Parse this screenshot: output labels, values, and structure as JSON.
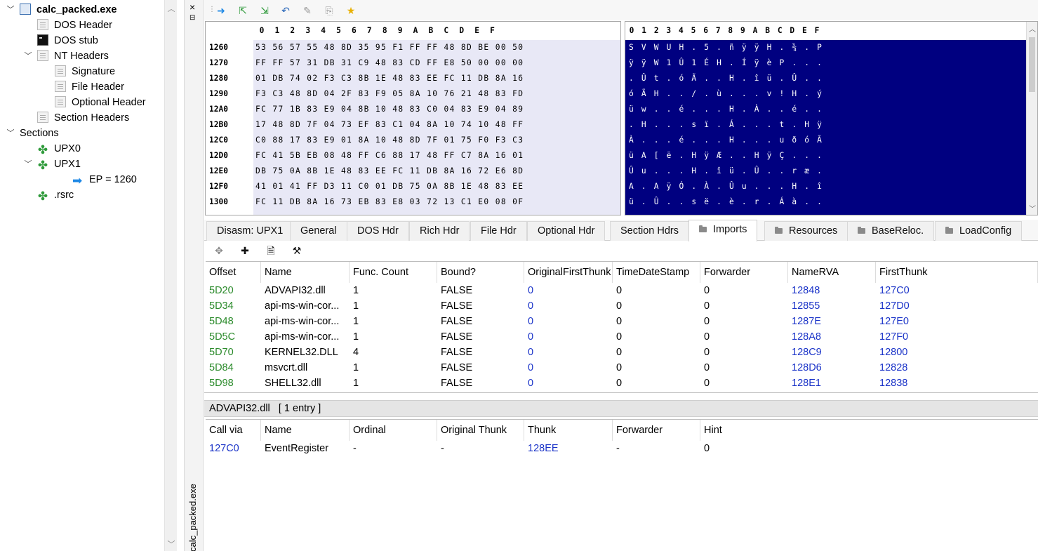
{
  "tree": {
    "items": [
      {
        "label": "calc_packed.exe",
        "icon": "exe-file-icon",
        "level": 0,
        "expanded": true,
        "bold": true
      },
      {
        "label": "DOS Header",
        "icon": "document-icon",
        "level": 1
      },
      {
        "label": "DOS stub",
        "icon": "dos-console-icon",
        "level": 1
      },
      {
        "label": "NT Headers",
        "icon": "document-icon",
        "level": 1,
        "expanded": true
      },
      {
        "label": "Signature",
        "icon": "document-icon",
        "level": 2
      },
      {
        "label": "File Header",
        "icon": "document-icon",
        "level": 2
      },
      {
        "label": "Optional Header",
        "icon": "document-icon",
        "level": 2
      },
      {
        "label": "Section Headers",
        "icon": "document-icon",
        "level": 1
      },
      {
        "label": "Sections",
        "icon": "none",
        "level": 0,
        "expanded": true
      },
      {
        "label": "UPX0",
        "icon": "puzzle-icon",
        "level": 1
      },
      {
        "label": "UPX1",
        "icon": "puzzle-icon",
        "level": 1,
        "expanded": true
      },
      {
        "label": "EP = 1260",
        "icon": "entry-point-arrow-icon",
        "level": 2
      },
      {
        "label": ".rsrc",
        "icon": "puzzle-icon",
        "level": 1
      }
    ]
  },
  "side_strip": {
    "close": "×",
    "pin": "⊟",
    "label": "calc_packed.exe"
  },
  "toolbar": {
    "buttons": [
      {
        "name": "go-to-address-icon",
        "glyph": "➜"
      },
      {
        "name": "go-to-entry-icon",
        "glyph": "⇱"
      },
      {
        "name": "go-to-rva-icon",
        "glyph": "⇲"
      },
      {
        "name": "undo-icon",
        "glyph": "↶"
      },
      {
        "name": "pin-icon",
        "glyph": "✎"
      },
      {
        "name": "copy-icon",
        "glyph": "⎘"
      },
      {
        "name": "favorite-star-icon",
        "glyph": "★"
      }
    ]
  },
  "hex": {
    "columns": [
      "0",
      "1",
      "2",
      "3",
      "4",
      "5",
      "6",
      "7",
      "8",
      "9",
      "A",
      "B",
      "C",
      "D",
      "E",
      "F"
    ],
    "rows": [
      {
        "addr": "1260",
        "bytes": "53 56 57 55 48 8D 35 95 F1 FF FF 48 8D BE 00 50",
        "ascii": "S V W U H . 5 . ñ ÿ ÿ H . ¾ . P"
      },
      {
        "addr": "1270",
        "bytes": "FF FF 57 31 DB 31 C9 48 83 CD FF E8 50 00 00 00",
        "ascii": "ÿ ÿ W 1 Û 1 É H . Í ÿ è P . . ."
      },
      {
        "addr": "1280",
        "bytes": "01 DB 74 02 F3 C3 8B 1E 48 83 EE FC 11 DB 8A 16",
        "ascii": ". Û t . ó Ã . . H . î ü . Û . ."
      },
      {
        "addr": "1290",
        "bytes": "F3 C3 48 8D 04 2F 83 F9 05 8A 10 76 21 48 83 FD",
        "ascii": "ó Ã H . . / . ù . . . v ! H . ý"
      },
      {
        "addr": "12A0",
        "bytes": "FC 77 1B 83 E9 04 8B 10 48 83 C0 04 83 E9 04 89",
        "ascii": "ü w . . é . . . H . À . . é . ."
      },
      {
        "addr": "12B0",
        "bytes": "17 48 8D 7F 04 73 EF 83 C1 04 8A 10 74 10 48 FF",
        "ascii": ". H . . . s ï . Á . . . t . H ÿ"
      },
      {
        "addr": "12C0",
        "bytes": "C0 88 17 83 E9 01 8A 10 48 8D 7F 01 75 F0 F3 C3",
        "ascii": "À . . . é . . . H . . . u ð ó Ã"
      },
      {
        "addr": "12D0",
        "bytes": "FC 41 5B EB 08 48 FF C6 88 17 48 FF C7 8A 16 01",
        "ascii": "ü A [ ë . H ÿ Æ . . H ÿ Ç . . ."
      },
      {
        "addr": "12E0",
        "bytes": "DB 75 0A 8B 1E 48 83 EE FC 11 DB 8A 16 72 E6 8D",
        "ascii": "Û u . . . H . î ü . Û . . r æ ."
      },
      {
        "addr": "12F0",
        "bytes": "41 01 41 FF D3 11 C0 01 DB 75 0A 8B 1E 48 83 EE",
        "ascii": "A . A ÿ Ó . À . Û u . . . H . î"
      },
      {
        "addr": "1300",
        "bytes": "FC 11 DB 8A 16 73 EB 83 E8 03 72 13 C1 E0 08 0F",
        "ascii": "ü . Û . . s ë . è . r . Á à . ."
      }
    ]
  },
  "tabs": [
    {
      "label": "Disasm: UPX1",
      "folder": false,
      "active": false
    },
    {
      "label": "General",
      "folder": false,
      "active": false
    },
    {
      "label": "DOS Hdr",
      "folder": false,
      "active": false
    },
    {
      "label": "Rich Hdr",
      "folder": false,
      "active": false
    },
    {
      "label": "File Hdr",
      "folder": false,
      "active": false
    },
    {
      "label": "Optional Hdr",
      "folder": false,
      "active": false
    },
    {
      "label": "Section Hdrs",
      "folder": false,
      "active": false
    },
    {
      "label": "Imports",
      "folder": true,
      "active": true
    },
    {
      "label": "Resources",
      "folder": true,
      "active": false
    },
    {
      "label": "BaseReloc.",
      "folder": true,
      "active": false
    },
    {
      "label": "LoadConfig",
      "folder": true,
      "active": false
    }
  ],
  "subtoolbar": [
    {
      "name": "move-icon",
      "glyph": "✥"
    },
    {
      "name": "add-icon",
      "glyph": "✚"
    },
    {
      "name": "save-icon",
      "glyph": "🗎"
    },
    {
      "name": "wand-icon",
      "glyph": "⚒"
    }
  ],
  "imports": {
    "headers": [
      "Offset",
      "Name",
      "Func. Count",
      "Bound?",
      "OriginalFirstThunk",
      "TimeDateStamp",
      "Forwarder",
      "NameRVA",
      "FirstThunk"
    ],
    "rows": [
      [
        "5D20",
        "ADVAPI32.dll",
        "1",
        "FALSE",
        "0",
        "0",
        "0",
        "12848",
        "127C0"
      ],
      [
        "5D34",
        "api-ms-win-cor...",
        "1",
        "FALSE",
        "0",
        "0",
        "0",
        "12855",
        "127D0"
      ],
      [
        "5D48",
        "api-ms-win-cor...",
        "1",
        "FALSE",
        "0",
        "0",
        "0",
        "1287E",
        "127E0"
      ],
      [
        "5D5C",
        "api-ms-win-cor...",
        "1",
        "FALSE",
        "0",
        "0",
        "0",
        "128A8",
        "127F0"
      ],
      [
        "5D70",
        "KERNEL32.DLL",
        "4",
        "FALSE",
        "0",
        "0",
        "0",
        "128C9",
        "12800"
      ],
      [
        "5D84",
        "msvcrt.dll",
        "1",
        "FALSE",
        "0",
        "0",
        "0",
        "128D6",
        "12828"
      ],
      [
        "5D98",
        "SHELL32.dll",
        "1",
        "FALSE",
        "0",
        "0",
        "0",
        "128E1",
        "12838"
      ]
    ]
  },
  "library": {
    "title": "ADVAPI32.dll   [ 1 entry ]",
    "headers": [
      "Call via",
      "Name",
      "Ordinal",
      "Original Thunk",
      "Thunk",
      "Forwarder",
      "Hint"
    ],
    "rows": [
      [
        "127C0",
        "EventRegister",
        "-",
        "-",
        "128EE",
        "-",
        "0"
      ]
    ]
  },
  "colors": {
    "offset": "#2a8a2a",
    "link": "#1a33c8",
    "hex_bg": "#e8e8f6",
    "ascii_bg": "#000080"
  }
}
